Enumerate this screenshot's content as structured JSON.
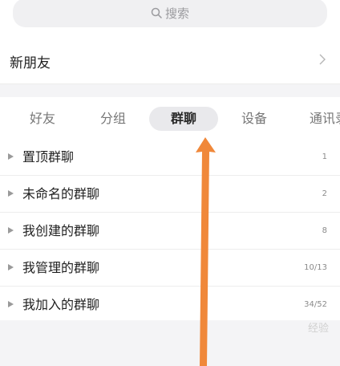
{
  "search": {
    "placeholder": "搜索",
    "icon": "search-icon"
  },
  "new_friends": {
    "label": "新朋友",
    "icon": "chevron-right-icon"
  },
  "tabs": [
    {
      "label": "好友",
      "active": false
    },
    {
      "label": "分组",
      "active": false
    },
    {
      "label": "群聊",
      "active": true
    },
    {
      "label": "设备",
      "active": false
    },
    {
      "label": "通讯录",
      "active": false
    }
  ],
  "groups": [
    {
      "name": "置顶群聊",
      "count": "1"
    },
    {
      "name": "未命名的群聊",
      "count": "2"
    },
    {
      "name": "我创建的群聊",
      "count": "8"
    },
    {
      "name": "我管理的群聊",
      "count": "10/13"
    },
    {
      "name": "我加入的群聊",
      "count": "34/52"
    }
  ],
  "colors": {
    "arrow": "#f0883a",
    "active_tab_bg": "#e9e9ec"
  },
  "watermark": "经验"
}
